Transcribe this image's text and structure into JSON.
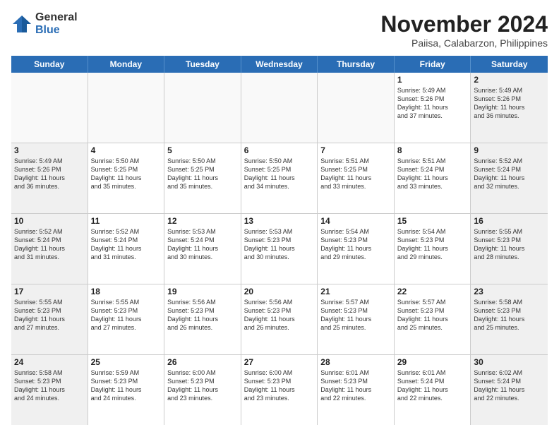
{
  "logo": {
    "general": "General",
    "blue": "Blue"
  },
  "title": "November 2024",
  "location": "Paiisa, Calabarzon, Philippines",
  "header_days": [
    "Sunday",
    "Monday",
    "Tuesday",
    "Wednesday",
    "Thursday",
    "Friday",
    "Saturday"
  ],
  "rows": [
    [
      {
        "day": "",
        "text": "",
        "empty": true
      },
      {
        "day": "",
        "text": "",
        "empty": true
      },
      {
        "day": "",
        "text": "",
        "empty": true
      },
      {
        "day": "",
        "text": "",
        "empty": true
      },
      {
        "day": "",
        "text": "",
        "empty": true
      },
      {
        "day": "1",
        "text": "Sunrise: 5:49 AM\nSunset: 5:26 PM\nDaylight: 11 hours\nand 37 minutes."
      },
      {
        "day": "2",
        "text": "Sunrise: 5:49 AM\nSunset: 5:26 PM\nDaylight: 11 hours\nand 36 minutes.",
        "shaded": true
      }
    ],
    [
      {
        "day": "3",
        "text": "Sunrise: 5:49 AM\nSunset: 5:26 PM\nDaylight: 11 hours\nand 36 minutes.",
        "shaded": true
      },
      {
        "day": "4",
        "text": "Sunrise: 5:50 AM\nSunset: 5:25 PM\nDaylight: 11 hours\nand 35 minutes."
      },
      {
        "day": "5",
        "text": "Sunrise: 5:50 AM\nSunset: 5:25 PM\nDaylight: 11 hours\nand 35 minutes."
      },
      {
        "day": "6",
        "text": "Sunrise: 5:50 AM\nSunset: 5:25 PM\nDaylight: 11 hours\nand 34 minutes."
      },
      {
        "day": "7",
        "text": "Sunrise: 5:51 AM\nSunset: 5:25 PM\nDaylight: 11 hours\nand 33 minutes."
      },
      {
        "day": "8",
        "text": "Sunrise: 5:51 AM\nSunset: 5:24 PM\nDaylight: 11 hours\nand 33 minutes."
      },
      {
        "day": "9",
        "text": "Sunrise: 5:52 AM\nSunset: 5:24 PM\nDaylight: 11 hours\nand 32 minutes.",
        "shaded": true
      }
    ],
    [
      {
        "day": "10",
        "text": "Sunrise: 5:52 AM\nSunset: 5:24 PM\nDaylight: 11 hours\nand 31 minutes.",
        "shaded": true
      },
      {
        "day": "11",
        "text": "Sunrise: 5:52 AM\nSunset: 5:24 PM\nDaylight: 11 hours\nand 31 minutes."
      },
      {
        "day": "12",
        "text": "Sunrise: 5:53 AM\nSunset: 5:24 PM\nDaylight: 11 hours\nand 30 minutes."
      },
      {
        "day": "13",
        "text": "Sunrise: 5:53 AM\nSunset: 5:23 PM\nDaylight: 11 hours\nand 30 minutes."
      },
      {
        "day": "14",
        "text": "Sunrise: 5:54 AM\nSunset: 5:23 PM\nDaylight: 11 hours\nand 29 minutes."
      },
      {
        "day": "15",
        "text": "Sunrise: 5:54 AM\nSunset: 5:23 PM\nDaylight: 11 hours\nand 29 minutes."
      },
      {
        "day": "16",
        "text": "Sunrise: 5:55 AM\nSunset: 5:23 PM\nDaylight: 11 hours\nand 28 minutes.",
        "shaded": true
      }
    ],
    [
      {
        "day": "17",
        "text": "Sunrise: 5:55 AM\nSunset: 5:23 PM\nDaylight: 11 hours\nand 27 minutes.",
        "shaded": true
      },
      {
        "day": "18",
        "text": "Sunrise: 5:55 AM\nSunset: 5:23 PM\nDaylight: 11 hours\nand 27 minutes."
      },
      {
        "day": "19",
        "text": "Sunrise: 5:56 AM\nSunset: 5:23 PM\nDaylight: 11 hours\nand 26 minutes."
      },
      {
        "day": "20",
        "text": "Sunrise: 5:56 AM\nSunset: 5:23 PM\nDaylight: 11 hours\nand 26 minutes."
      },
      {
        "day": "21",
        "text": "Sunrise: 5:57 AM\nSunset: 5:23 PM\nDaylight: 11 hours\nand 25 minutes."
      },
      {
        "day": "22",
        "text": "Sunrise: 5:57 AM\nSunset: 5:23 PM\nDaylight: 11 hours\nand 25 minutes."
      },
      {
        "day": "23",
        "text": "Sunrise: 5:58 AM\nSunset: 5:23 PM\nDaylight: 11 hours\nand 25 minutes.",
        "shaded": true
      }
    ],
    [
      {
        "day": "24",
        "text": "Sunrise: 5:58 AM\nSunset: 5:23 PM\nDaylight: 11 hours\nand 24 minutes.",
        "shaded": true
      },
      {
        "day": "25",
        "text": "Sunrise: 5:59 AM\nSunset: 5:23 PM\nDaylight: 11 hours\nand 24 minutes."
      },
      {
        "day": "26",
        "text": "Sunrise: 6:00 AM\nSunset: 5:23 PM\nDaylight: 11 hours\nand 23 minutes."
      },
      {
        "day": "27",
        "text": "Sunrise: 6:00 AM\nSunset: 5:23 PM\nDaylight: 11 hours\nand 23 minutes."
      },
      {
        "day": "28",
        "text": "Sunrise: 6:01 AM\nSunset: 5:23 PM\nDaylight: 11 hours\nand 22 minutes."
      },
      {
        "day": "29",
        "text": "Sunrise: 6:01 AM\nSunset: 5:24 PM\nDaylight: 11 hours\nand 22 minutes."
      },
      {
        "day": "30",
        "text": "Sunrise: 6:02 AM\nSunset: 5:24 PM\nDaylight: 11 hours\nand 22 minutes.",
        "shaded": true
      }
    ]
  ]
}
